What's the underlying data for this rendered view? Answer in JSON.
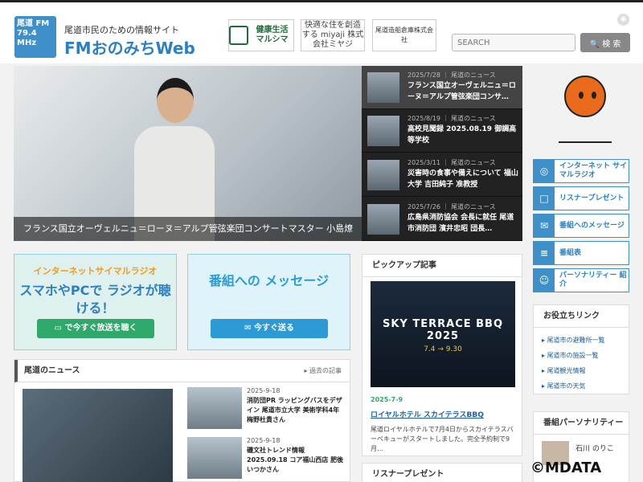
{
  "header": {
    "logo_badge": "尾道 FM 79.4 MHz",
    "subtitle": "尾道市民のための情報サイト",
    "title": "FMおのみちWeb",
    "sponsors": [
      "健康生活 マルシマ",
      "快適な住を創造する miyaji 株式会社ミヤジ",
      "尾道造船倉庫株式会社"
    ],
    "search_placeholder": "SEARCH",
    "search_label": "検 索"
  },
  "hero": {
    "caption": "フランス国立オーヴェルニュ＝ローヌ＝アルプ管弦楽団コンサートマスター 小島燎さん"
  },
  "news_panel": [
    {
      "date": "2025/7/28",
      "category": "尾道のニュース",
      "title": "フランス国立オーヴェルニュ＝ローヌ＝アルプ管弦楽団コンサ…"
    },
    {
      "date": "2025/8/19",
      "category": "尾道のニュース",
      "title": "高校見聞録 2025.08.19 御調高等学校"
    },
    {
      "date": "2025/3/11",
      "category": "尾道のニュース",
      "title": "災害時の食事や備えについて 福山大学 吉田純子 准教授"
    },
    {
      "date": "2025/7/26",
      "category": "尾道のニュース",
      "title": "広島県消防協会 会長に就任 尾道市消防団 濱井忠昭 団長…"
    }
  ],
  "side_menu": [
    {
      "icon": "radio-icon",
      "glyph": "◎",
      "label": "インターネット サイマルラジオ"
    },
    {
      "icon": "gift-icon",
      "glyph": "□",
      "label": "リスナープレゼント"
    },
    {
      "icon": "mail-icon",
      "glyph": "✉",
      "label": "番組へのメッセージ"
    },
    {
      "icon": "schedule-icon",
      "glyph": "≡",
      "label": "番組表"
    },
    {
      "icon": "people-icon",
      "glyph": "☺",
      "label": "パーソナリティー 紹介"
    }
  ],
  "banners": {
    "radio": {
      "top": "インターネットサイマルラジオ",
      "main": "スマホやPCで ラジオが聴ける！",
      "button": "で今すぐ放送を聴く"
    },
    "message": {
      "main": "番組への メッセージ",
      "button": "今すぐ送る"
    }
  },
  "local_news": {
    "title": "尾道のニュース",
    "more": "過去の記事",
    "items": [
      {
        "date": "2025-9-18",
        "title": "消防団PR ラッピングバスをデザイン 尾道市立大学 美術学科4年 梅野杜貴さん"
      },
      {
        "date": "2025-9-18",
        "title": "磯文社トレンド情報 2025.09.18 コア福山西店 肥後いつかさん"
      }
    ]
  },
  "pickup": {
    "title": "ピックアップ記事",
    "poster_title": "SKY TERRACE BBQ 2025",
    "poster_dates": "7.4 → 9.30",
    "date": "2025-7-9",
    "link": "ロイヤルホテル スカイテラスBBQ",
    "desc": "尾道ロイヤルホテルで7月4日からスカイテラスバーベキューがスタートしました。完全予約制で9月…"
  },
  "present": {
    "title": "リスナープレゼント"
  },
  "useful": {
    "title": "お役立ちリンク",
    "links": [
      "尾道市の避難所一覧",
      "尾道市の施設一覧",
      "尾道観光情報",
      "尾道市の天気"
    ]
  },
  "personality": {
    "title": "番組パーソナリティー",
    "name": "石川 のりこ"
  },
  "watermark": "©MDATA"
}
